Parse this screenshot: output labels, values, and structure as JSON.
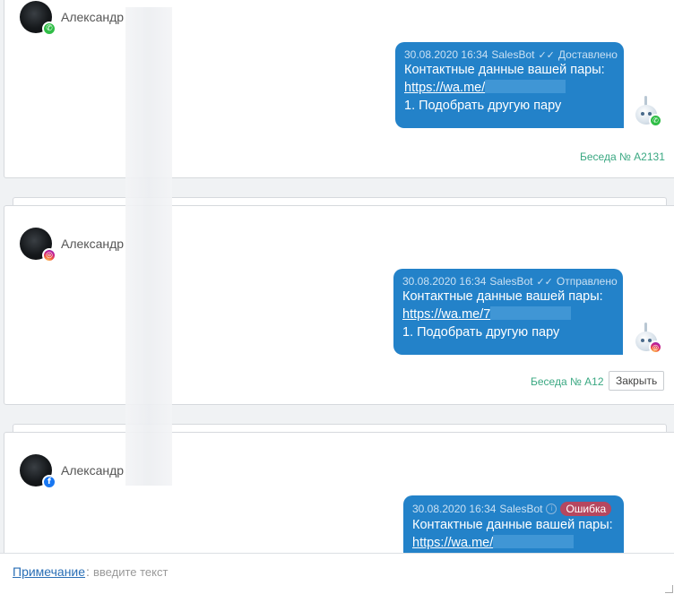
{
  "conversations": [
    {
      "contact_name": "Александр",
      "channel": "whatsapp",
      "message": {
        "date": "30.08.2020 16:34",
        "sender": "SalesBot",
        "status": "Доставлено",
        "line1": "Контактные данные вашей пары:",
        "link": "https://wa.me/",
        "line3": "1. Подобрать другую пару"
      },
      "conversation_label": "Беседа № А2131"
    },
    {
      "contact_name": "Александр",
      "channel": "instagram",
      "message": {
        "date": "30.08.2020 16:34",
        "sender": "SalesBot",
        "status": "Отправлено",
        "line1": "Контактные данные вашей пары:",
        "link": "https://wa.me/7",
        "line3": "1. Подобрать другую пару"
      },
      "conversation_label": "Беседа № А12",
      "close_label": "Закрыть"
    },
    {
      "contact_name": "Александр",
      "channel": "facebook",
      "message": {
        "date": "30.08.2020 16:34",
        "sender": "SalesBot",
        "status": "Ошибка",
        "line1": "Контактные данные вашей пары:",
        "link": "https://wa.me/"
      }
    }
  ],
  "note": {
    "label": "Примечание",
    "separator": ":",
    "placeholder": "введите текст"
  },
  "colors": {
    "bubble": "#2382c9",
    "conversation_link": "#3aa882",
    "error_badge": "#b5475f",
    "whatsapp": "#2fbd46",
    "facebook": "#1877f2"
  }
}
